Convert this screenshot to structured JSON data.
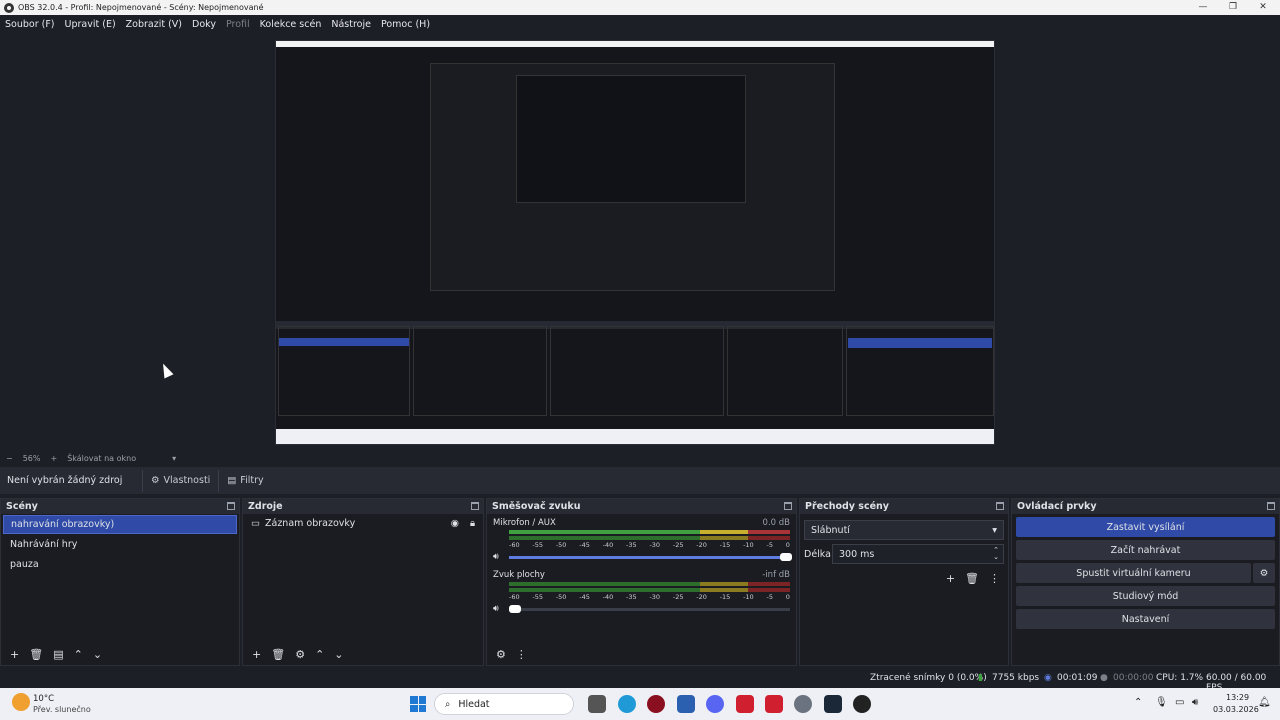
{
  "window": {
    "title": "OBS 32.0.4 - Profil: Nepojmenované - Scény: Nepojmenované"
  },
  "menu": [
    {
      "label": "Soubor (F)",
      "disabled": false
    },
    {
      "label": "Upravit (E)",
      "disabled": false
    },
    {
      "label": "Zobrazit (V)",
      "disabled": false
    },
    {
      "label": "Doky",
      "disabled": false
    },
    {
      "label": "Profil",
      "disabled": true
    },
    {
      "label": "Kolekce scén",
      "disabled": false
    },
    {
      "label": "Nástroje",
      "disabled": false
    },
    {
      "label": "Pomoc (H)",
      "disabled": false
    }
  ],
  "preview_status": {
    "minus": "−",
    "zoom": "56%",
    "plus": "+",
    "scale": "Škálovat na okno"
  },
  "source_bar": {
    "no_source": "Není vybrán žádný zdroj",
    "properties": "Vlastnosti",
    "filters": "Filtry"
  },
  "scenes": {
    "title": "Scény",
    "items": [
      {
        "label": "nahravání obrazovky)",
        "selected": true
      },
      {
        "label": "Nahrávání hry",
        "selected": false
      },
      {
        "label": "pauza",
        "selected": false
      }
    ]
  },
  "sources": {
    "title": "Zdroje",
    "items": [
      {
        "label": "Záznam obrazovky"
      }
    ]
  },
  "mixer": {
    "title": "Směšovač zvuku",
    "ticks": [
      "-60",
      "-55",
      "-50",
      "-45",
      "-40",
      "-35",
      "-30",
      "-25",
      "-20",
      "-15",
      "-10",
      "-5",
      "0"
    ],
    "tracks": [
      {
        "name": "Mikrofon / AUX",
        "db": "0.0 dB"
      },
      {
        "name": "Zvuk plochy",
        "db": "-inf dB"
      }
    ]
  },
  "transitions": {
    "title": "Přechody scény",
    "selected": "Slábnutí",
    "duration_label": "Délka",
    "duration_value": "300 ms"
  },
  "controls": {
    "title": "Ovládací prvky",
    "stop_stream": "Zastavit vysílání",
    "start_record": "Začít nahrávat",
    "virtual_cam": "Spustit virtuální kameru",
    "studio_mode": "Studiový mód",
    "settings": "Nastavení"
  },
  "status": {
    "dropped": "Ztracené snímky 0 (0.0%)",
    "bitrate": "7755 kbps",
    "stream_time": "00:01:09",
    "record_time": "00:00:00",
    "cpu": "CPU: 1.7%",
    "fps": "60.00 / 60.00 FPS"
  },
  "taskbar": {
    "weather_temp": "10°C",
    "weather_desc": "Přev. slunečno",
    "search": "Hledat",
    "time": "13:29",
    "date": "03.03.2026"
  }
}
